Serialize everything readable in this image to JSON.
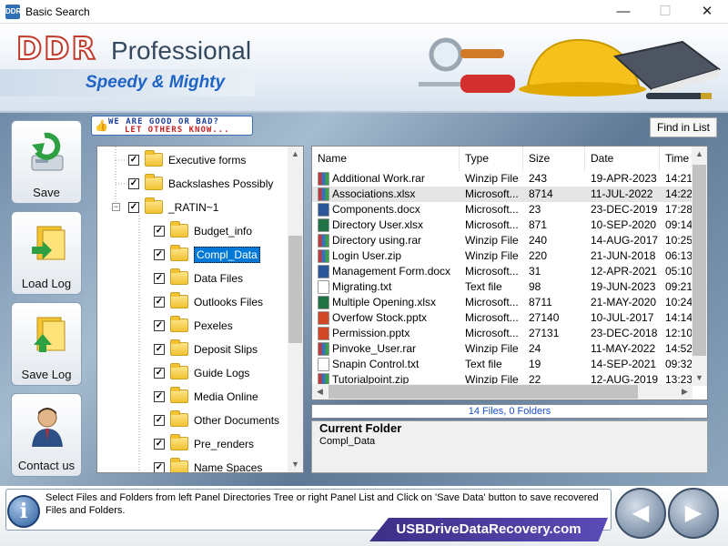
{
  "window": {
    "title": "Basic Search",
    "icon_label": "DDR",
    "minimize": "—",
    "maximize": "☐",
    "close": "✕"
  },
  "banner": {
    "logo_ddr": "DDR",
    "logo_professional": "Professional",
    "tagline": "Speedy & Mighty"
  },
  "sidebar": {
    "items": [
      {
        "label": "Save",
        "icon": "save-disk-icon"
      },
      {
        "label": "Load Log",
        "icon": "load-log-icon"
      },
      {
        "label": "Save Log",
        "icon": "save-log-icon"
      },
      {
        "label": "Contact us",
        "icon": "contact-person-icon"
      }
    ]
  },
  "ad": {
    "line1": "WE ARE GOOD OR BAD?",
    "line2": "LET OTHERS KNOW...",
    "thumb": "👍"
  },
  "toolbar": {
    "find_label": "Find in List"
  },
  "tree": {
    "expander": "−",
    "check": "✓",
    "items": [
      {
        "label": "Executive forms",
        "level": 1,
        "checked": true,
        "selected": false
      },
      {
        "label": "Backslashes Possibly",
        "level": 1,
        "checked": true,
        "selected": false
      },
      {
        "label": "_RATIN~1",
        "level": 1,
        "checked": true,
        "selected": false,
        "expanded": true
      },
      {
        "label": "Budget_info",
        "level": 2,
        "checked": true,
        "selected": false
      },
      {
        "label": "Compl_Data",
        "level": 2,
        "checked": true,
        "selected": true
      },
      {
        "label": "Data Files",
        "level": 2,
        "checked": true,
        "selected": false
      },
      {
        "label": "Outlooks Files",
        "level": 2,
        "checked": true,
        "selected": false
      },
      {
        "label": "Pexeles",
        "level": 2,
        "checked": true,
        "selected": false
      },
      {
        "label": "Deposit Slips",
        "level": 2,
        "checked": true,
        "selected": false
      },
      {
        "label": "Guide Logs",
        "level": 2,
        "checked": true,
        "selected": false
      },
      {
        "label": "Media Online",
        "level": 2,
        "checked": true,
        "selected": false
      },
      {
        "label": "Other Documents",
        "level": 2,
        "checked": true,
        "selected": false
      },
      {
        "label": "Pre_renders",
        "level": 2,
        "checked": true,
        "selected": false
      },
      {
        "label": "Name Spaces",
        "level": 2,
        "checked": true,
        "selected": false
      }
    ]
  },
  "file_list": {
    "columns": [
      "Name",
      "Type",
      "Size",
      "Date",
      "Time"
    ],
    "rows": [
      {
        "name": "Additional Work.rar",
        "type": "Winzip File",
        "size": "243",
        "date": "19-APR-2023",
        "time": "14:21",
        "kind": "archive"
      },
      {
        "name": "Associations.xlsx",
        "type": "Microsoft...",
        "size": "8714",
        "date": "11-JUL-2022",
        "time": "14:22",
        "kind": "archive",
        "highlight": true
      },
      {
        "name": "Components.docx",
        "type": "Microsoft...",
        "size": "23",
        "date": "23-DEC-2019",
        "time": "17:28",
        "kind": "word"
      },
      {
        "name": "Directory User.xlsx",
        "type": "Microsoft...",
        "size": "871",
        "date": "10-SEP-2020",
        "time": "09:14",
        "kind": "excel"
      },
      {
        "name": "Directory using.rar",
        "type": "Winzip File",
        "size": "240",
        "date": "14-AUG-2017",
        "time": "10:25",
        "kind": "archive"
      },
      {
        "name": "Login User.zip",
        "type": "Winzip File",
        "size": "220",
        "date": "21-JUN-2018",
        "time": "06:13",
        "kind": "archive"
      },
      {
        "name": "Management Form.docx",
        "type": "Microsoft...",
        "size": "31",
        "date": "12-APR-2021",
        "time": "05:10",
        "kind": "word"
      },
      {
        "name": "Migrating.txt",
        "type": "Text file",
        "size": "98",
        "date": "19-JUN-2023",
        "time": "09:21",
        "kind": "text"
      },
      {
        "name": "Multiple Opening.xlsx",
        "type": "Microsoft...",
        "size": "8711",
        "date": "21-MAY-2020",
        "time": "10:24",
        "kind": "excel"
      },
      {
        "name": "Overfow Stock.pptx",
        "type": "Microsoft...",
        "size": "27140",
        "date": "10-JUL-2017",
        "time": "14:14",
        "kind": "ppt"
      },
      {
        "name": "Permission.pptx",
        "type": "Microsoft...",
        "size": "27131",
        "date": "23-DEC-2018",
        "time": "12:10",
        "kind": "ppt"
      },
      {
        "name": "Pinvoke_User.rar",
        "type": "Winzip File",
        "size": "24",
        "date": "11-MAY-2022",
        "time": "14:52",
        "kind": "archive"
      },
      {
        "name": "Snapin Control.txt",
        "type": "Text file",
        "size": "19",
        "date": "14-SEP-2021",
        "time": "09:32",
        "kind": "text"
      },
      {
        "name": "Tutorialpoint.zip",
        "type": "Winzip File",
        "size": "22",
        "date": "12-AUG-2019",
        "time": "13:23",
        "kind": "archive"
      }
    ]
  },
  "status": {
    "summary": "14 Files, 0 Folders"
  },
  "current_folder": {
    "heading": "Current Folder",
    "value": "Compl_Data"
  },
  "info": {
    "icon_label": "i",
    "message": "Select Files and Folders from left Panel Directories Tree or right Panel List and Click on 'Save Data' button to save recovered Files and Folders."
  },
  "footer": {
    "url": "USBDriveDataRecovery.com",
    "back": "◀",
    "next": "▶"
  },
  "scroll": {
    "up": "▲",
    "down": "▼",
    "left": "◀",
    "right": "▶"
  },
  "colors": {
    "accent": "#0078d7",
    "status_text": "#1a4fd0",
    "logo_red": "#c0392b",
    "tagline_blue": "#1e63c5"
  }
}
